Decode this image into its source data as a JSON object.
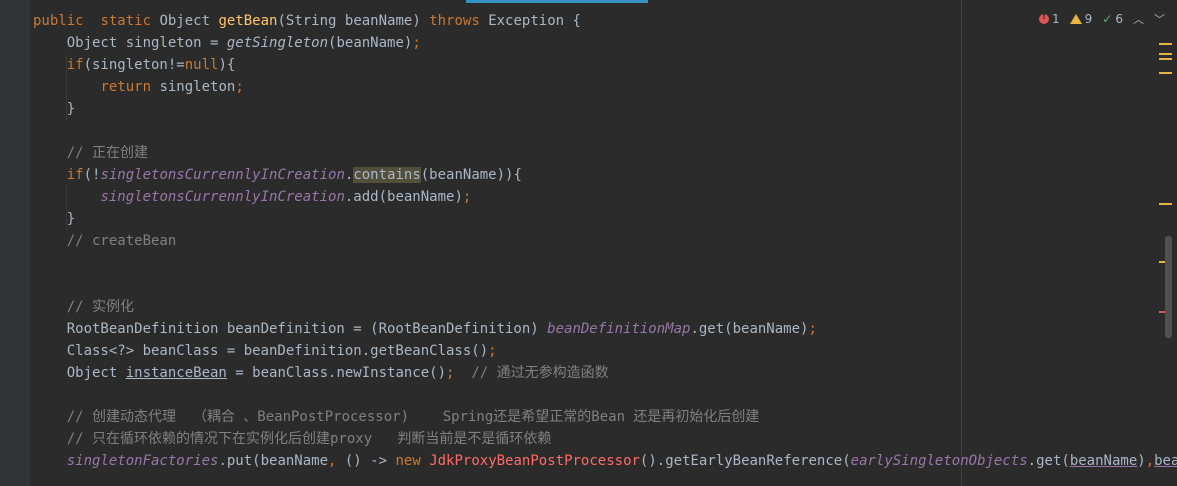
{
  "code_lines": [
    [
      {
        "t": "public",
        "c": "kw"
      },
      {
        "t": "  "
      },
      {
        "t": "static",
        "c": "kw"
      },
      {
        "t": " Object "
      },
      {
        "t": "getBean",
        "c": "fn"
      },
      {
        "t": "(String beanName) "
      },
      {
        "t": "throws",
        "c": "kw"
      },
      {
        "t": " Exception {"
      }
    ],
    [
      {
        "t": "    Object singleton = "
      },
      {
        "t": "getSingleton",
        "c": "fld-i"
      },
      {
        "t": "(beanName)"
      },
      {
        "t": ";",
        "c": "kw"
      }
    ],
    [
      {
        "t": "    "
      },
      {
        "t": "if",
        "c": "kw"
      },
      {
        "t": "(singleton!="
      },
      {
        "t": "null",
        "c": "kw"
      },
      {
        "t": "){"
      }
    ],
    [
      {
        "t": "        "
      },
      {
        "t": "return",
        "c": "kw"
      },
      {
        "t": " singleton"
      },
      {
        "t": ";",
        "c": "kw"
      }
    ],
    [
      {
        "t": "    }"
      }
    ],
    [
      {
        "t": ""
      }
    ],
    [
      {
        "t": "    "
      },
      {
        "t": "// 正在创建",
        "c": "cm"
      }
    ],
    [
      {
        "t": "    "
      },
      {
        "t": "if",
        "c": "kw"
      },
      {
        "t": "(!"
      },
      {
        "t": "singletonsCurrennlyInCreation",
        "c": "fld"
      },
      {
        "t": "."
      },
      {
        "t": "contains",
        "c": "hl"
      },
      {
        "t": "(beanName)){"
      }
    ],
    [
      {
        "t": "        "
      },
      {
        "t": "singletonsCurrennlyInCreation",
        "c": "fld"
      },
      {
        "t": ".add(beanName)"
      },
      {
        "t": ";",
        "c": "kw"
      }
    ],
    [
      {
        "t": "    }"
      }
    ],
    [
      {
        "t": "    "
      },
      {
        "t": "// createBean",
        "c": "cm"
      }
    ],
    [
      {
        "t": ""
      }
    ],
    [
      {
        "t": ""
      }
    ],
    [
      {
        "t": "    "
      },
      {
        "t": "// 实例化",
        "c": "cm"
      }
    ],
    [
      {
        "t": "    RootBeanDefinition beanDefinition = (RootBeanDefinition) "
      },
      {
        "t": "beanDefinitionMap",
        "c": "fld"
      },
      {
        "t": ".get(beanName)"
      },
      {
        "t": ";",
        "c": "kw"
      }
    ],
    [
      {
        "t": "    Class<?> beanClass = beanDefinition.getBeanClass()"
      },
      {
        "t": ";",
        "c": "kw"
      }
    ],
    [
      {
        "t": "    Object "
      },
      {
        "t": "instanceBean",
        "c": "ul"
      },
      {
        "t": " = beanClass.newInstance()"
      },
      {
        "t": ";",
        "c": "kw"
      },
      {
        "t": "  "
      },
      {
        "t": "// 通过无参构造函数",
        "c": "cm"
      }
    ],
    [
      {
        "t": ""
      }
    ],
    [
      {
        "t": "    "
      },
      {
        "t": "// 创建动态代理  （耦合 、BeanPostProcessor)    Spring还是希望正常的Bean 还是再初始化后创建",
        "c": "cm"
      }
    ],
    [
      {
        "t": "    "
      },
      {
        "t": "// 只在循环依赖的情况下在实例化后创建proxy   判断当前是不是循环依赖",
        "c": "cm"
      }
    ],
    [
      {
        "t": "    "
      },
      {
        "t": "singletonFactories",
        "c": "fld"
      },
      {
        "t": ".put(beanName"
      },
      {
        "t": ",",
        "c": "kw"
      },
      {
        "t": " () -> "
      },
      {
        "t": "new",
        "c": "kw"
      },
      {
        "t": " "
      },
      {
        "t": "JdkProxyBeanPostProcessor",
        "c": "red"
      },
      {
        "t": "().getEarlyBeanReference("
      },
      {
        "t": "earlySingletonObjects",
        "c": "fld"
      },
      {
        "t": ".get("
      },
      {
        "t": "beanName",
        "c": "ulp"
      },
      {
        "t": ")"
      },
      {
        "t": ",",
        "c": "kw"
      },
      {
        "t": "beanName",
        "c": "ulp"
      },
      {
        "t": "))"
      },
      {
        "t": ";",
        "c": "kw"
      }
    ]
  ],
  "inspections": {
    "errors": "1",
    "warnings": "9",
    "typos": "6"
  },
  "colors": {
    "background": "#2b2b2b",
    "keyword": "#cc7832",
    "function": "#ffc66d",
    "comment": "#808080",
    "field": "#9876aa",
    "text": "#a9b7c6",
    "error": "#e05555",
    "warning": "#e8b441"
  }
}
